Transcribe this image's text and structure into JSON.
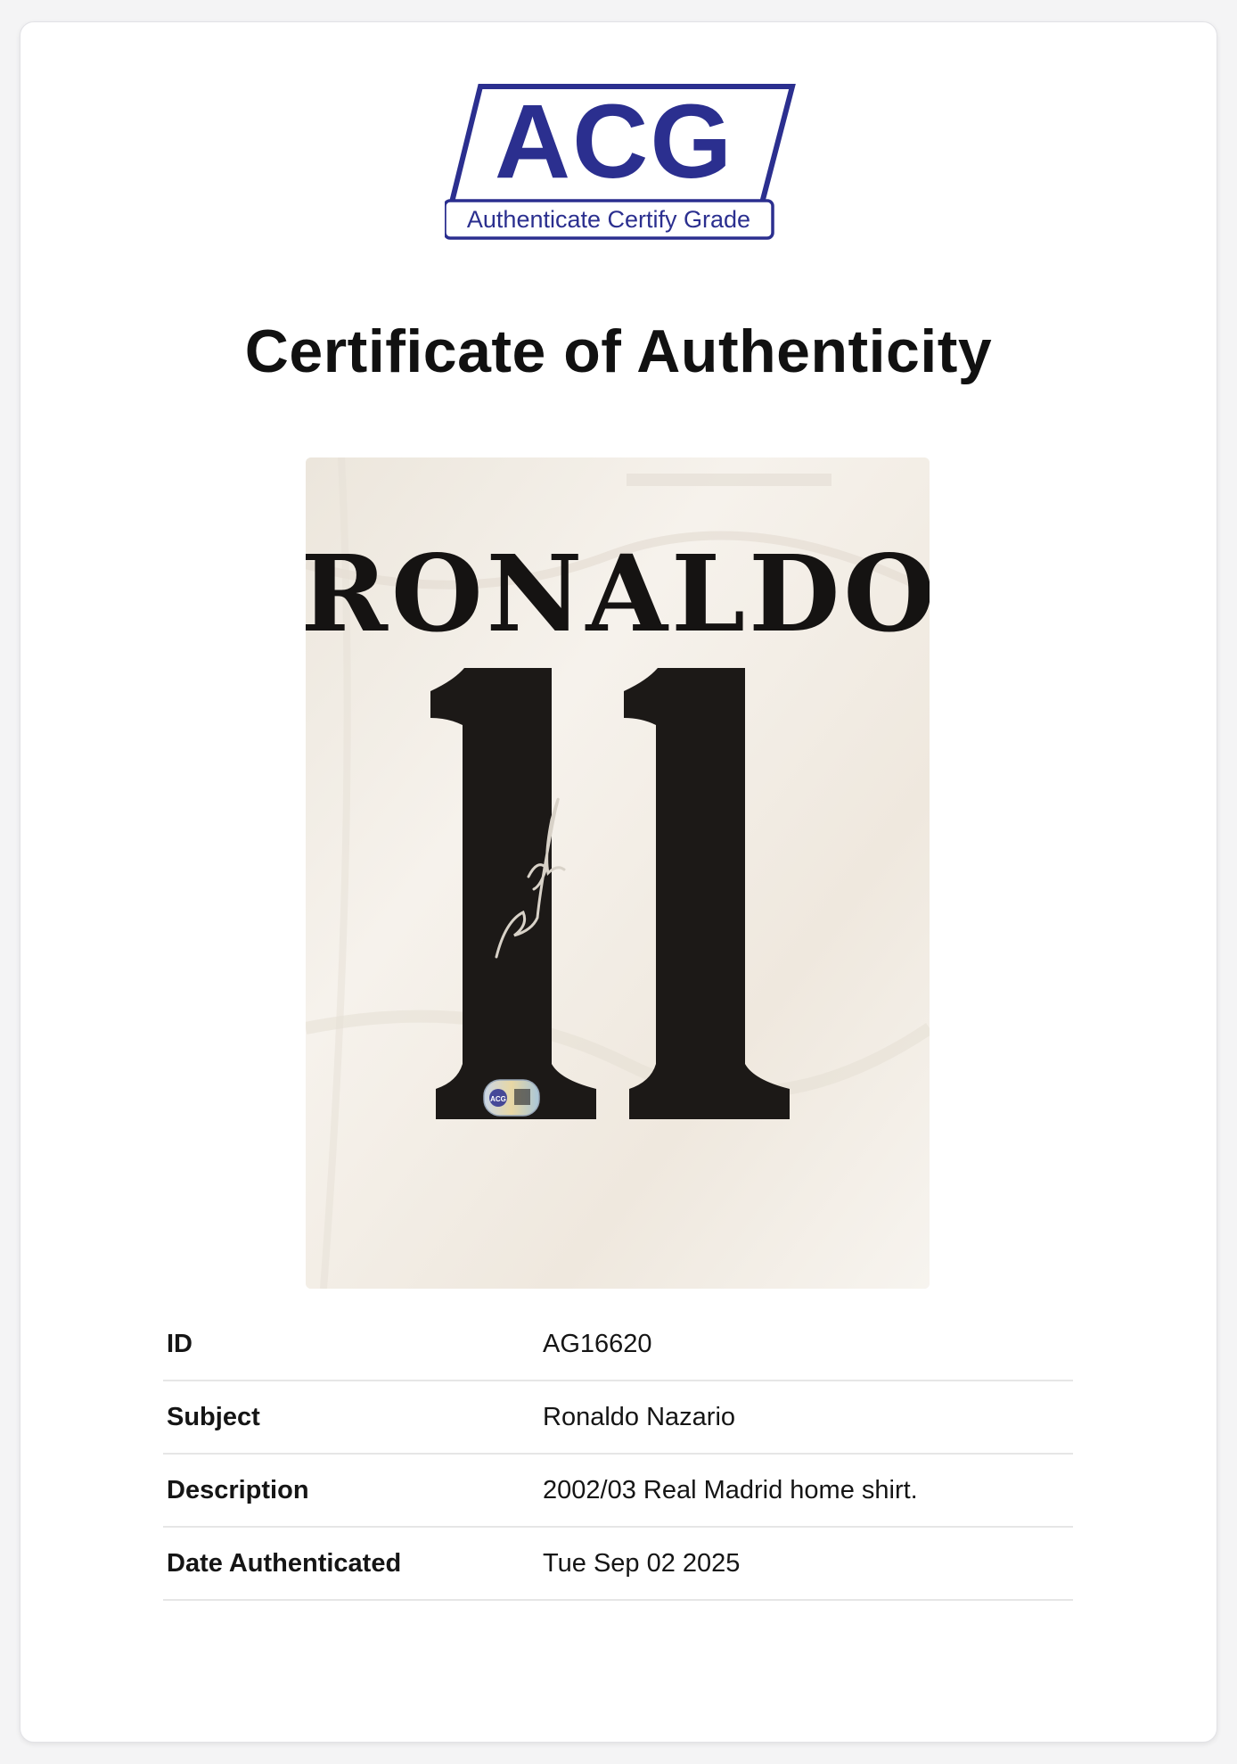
{
  "logo": {
    "wordmark": "ACG",
    "tagline": "Authenticate Certify Grade",
    "color": "#2b2f8f"
  },
  "title": "Certificate of Authenticity",
  "photo": {
    "name_on_shirt": "RONALDO",
    "number_on_shirt": "11",
    "sticker_text": "ACG"
  },
  "details": [
    {
      "label": "ID",
      "value": "AG16620"
    },
    {
      "label": "Subject",
      "value": "Ronaldo Nazario"
    },
    {
      "label": "Description",
      "value": "2002/03 Real Madrid home shirt."
    },
    {
      "label": "Date Authenticated",
      "value": "Tue Sep 02 2025"
    }
  ]
}
